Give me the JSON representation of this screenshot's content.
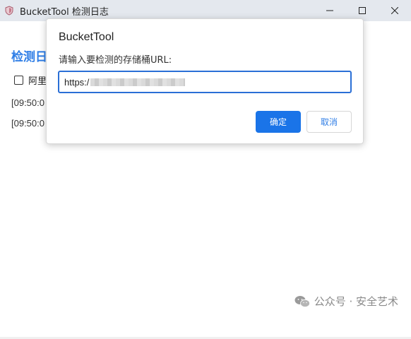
{
  "window": {
    "title": "BucketTool 检测日志",
    "icon": "shield-icon",
    "controls": [
      "minimize-icon",
      "maximize-icon",
      "close-icon"
    ]
  },
  "main": {
    "heading": "检测日",
    "aliyun_checkbox_label": "阿里",
    "aliyun_checked": false,
    "log_lines": [
      "[09:50:0",
      "[09:50:0"
    ]
  },
  "dialog": {
    "title": "BucketTool",
    "prompt": "请输入要检测的存储桶URL:",
    "input_value": "https:/",
    "ok_label": "确定",
    "cancel_label": "取消"
  },
  "watermark": {
    "text": "公众号 · 安全艺术",
    "icon": "wechat-icon"
  },
  "colors": {
    "accent": "#1a74e8",
    "heading": "#2f7ee6",
    "titlebar": "#e4e8ee"
  }
}
